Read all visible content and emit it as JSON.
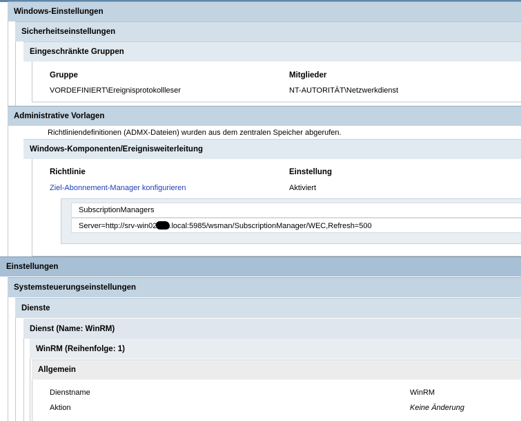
{
  "windows_settings": {
    "title": "Windows-Einstellungen",
    "security": {
      "title": "Sicherheitseinstellungen",
      "restricted_groups": {
        "title": "Eingeschränkte Gruppen",
        "headers": {
          "group": "Gruppe",
          "members": "Mitglieder"
        },
        "rows": [
          {
            "group": "VORDEFINIERT\\Ereignisprotokollleser",
            "members": "NT-AUTORITÄT\\Netzwerkdienst"
          }
        ]
      }
    }
  },
  "admin_templates": {
    "title": "Administrative Vorlagen",
    "note": "Richtliniendefinitionen (ADMX-Dateien) wurden aus dem zentralen Speicher abgerufen.",
    "component": {
      "title": "Windows-Komponenten/Ereignisweiterleitung",
      "headers": {
        "policy": "Richtlinie",
        "setting": "Einstellung"
      },
      "policy_link": "Ziel-Abonnement-Manager konfigurieren",
      "policy_value": "Aktiviert",
      "detail": {
        "label": "SubscriptionManagers",
        "value_prefix": "Server=http://srv-win02",
        "value_suffix": ".local:5985/wsman/SubscriptionManager/WEC,Refresh=500"
      }
    }
  },
  "preferences": {
    "title": "Einstellungen",
    "control_panel": {
      "title": "Systemsteuerungseinstellungen",
      "services": {
        "title": "Dienste",
        "service": {
          "title": "Dienst (Name: WinRM)",
          "item": {
            "title": "WinRM (Reihenfolge: 1)",
            "general": {
              "title": "Allgemein",
              "rows": [
                {
                  "label": "Dienstname",
                  "value": "WinRM"
                },
                {
                  "label": "Aktion",
                  "value": "Keine Änderung"
                }
              ]
            }
          }
        }
      }
    }
  },
  "colors": {
    "link": "#1f3fb5",
    "header_blue": "#c2d3e1",
    "header_top": "#a7c0d5"
  }
}
